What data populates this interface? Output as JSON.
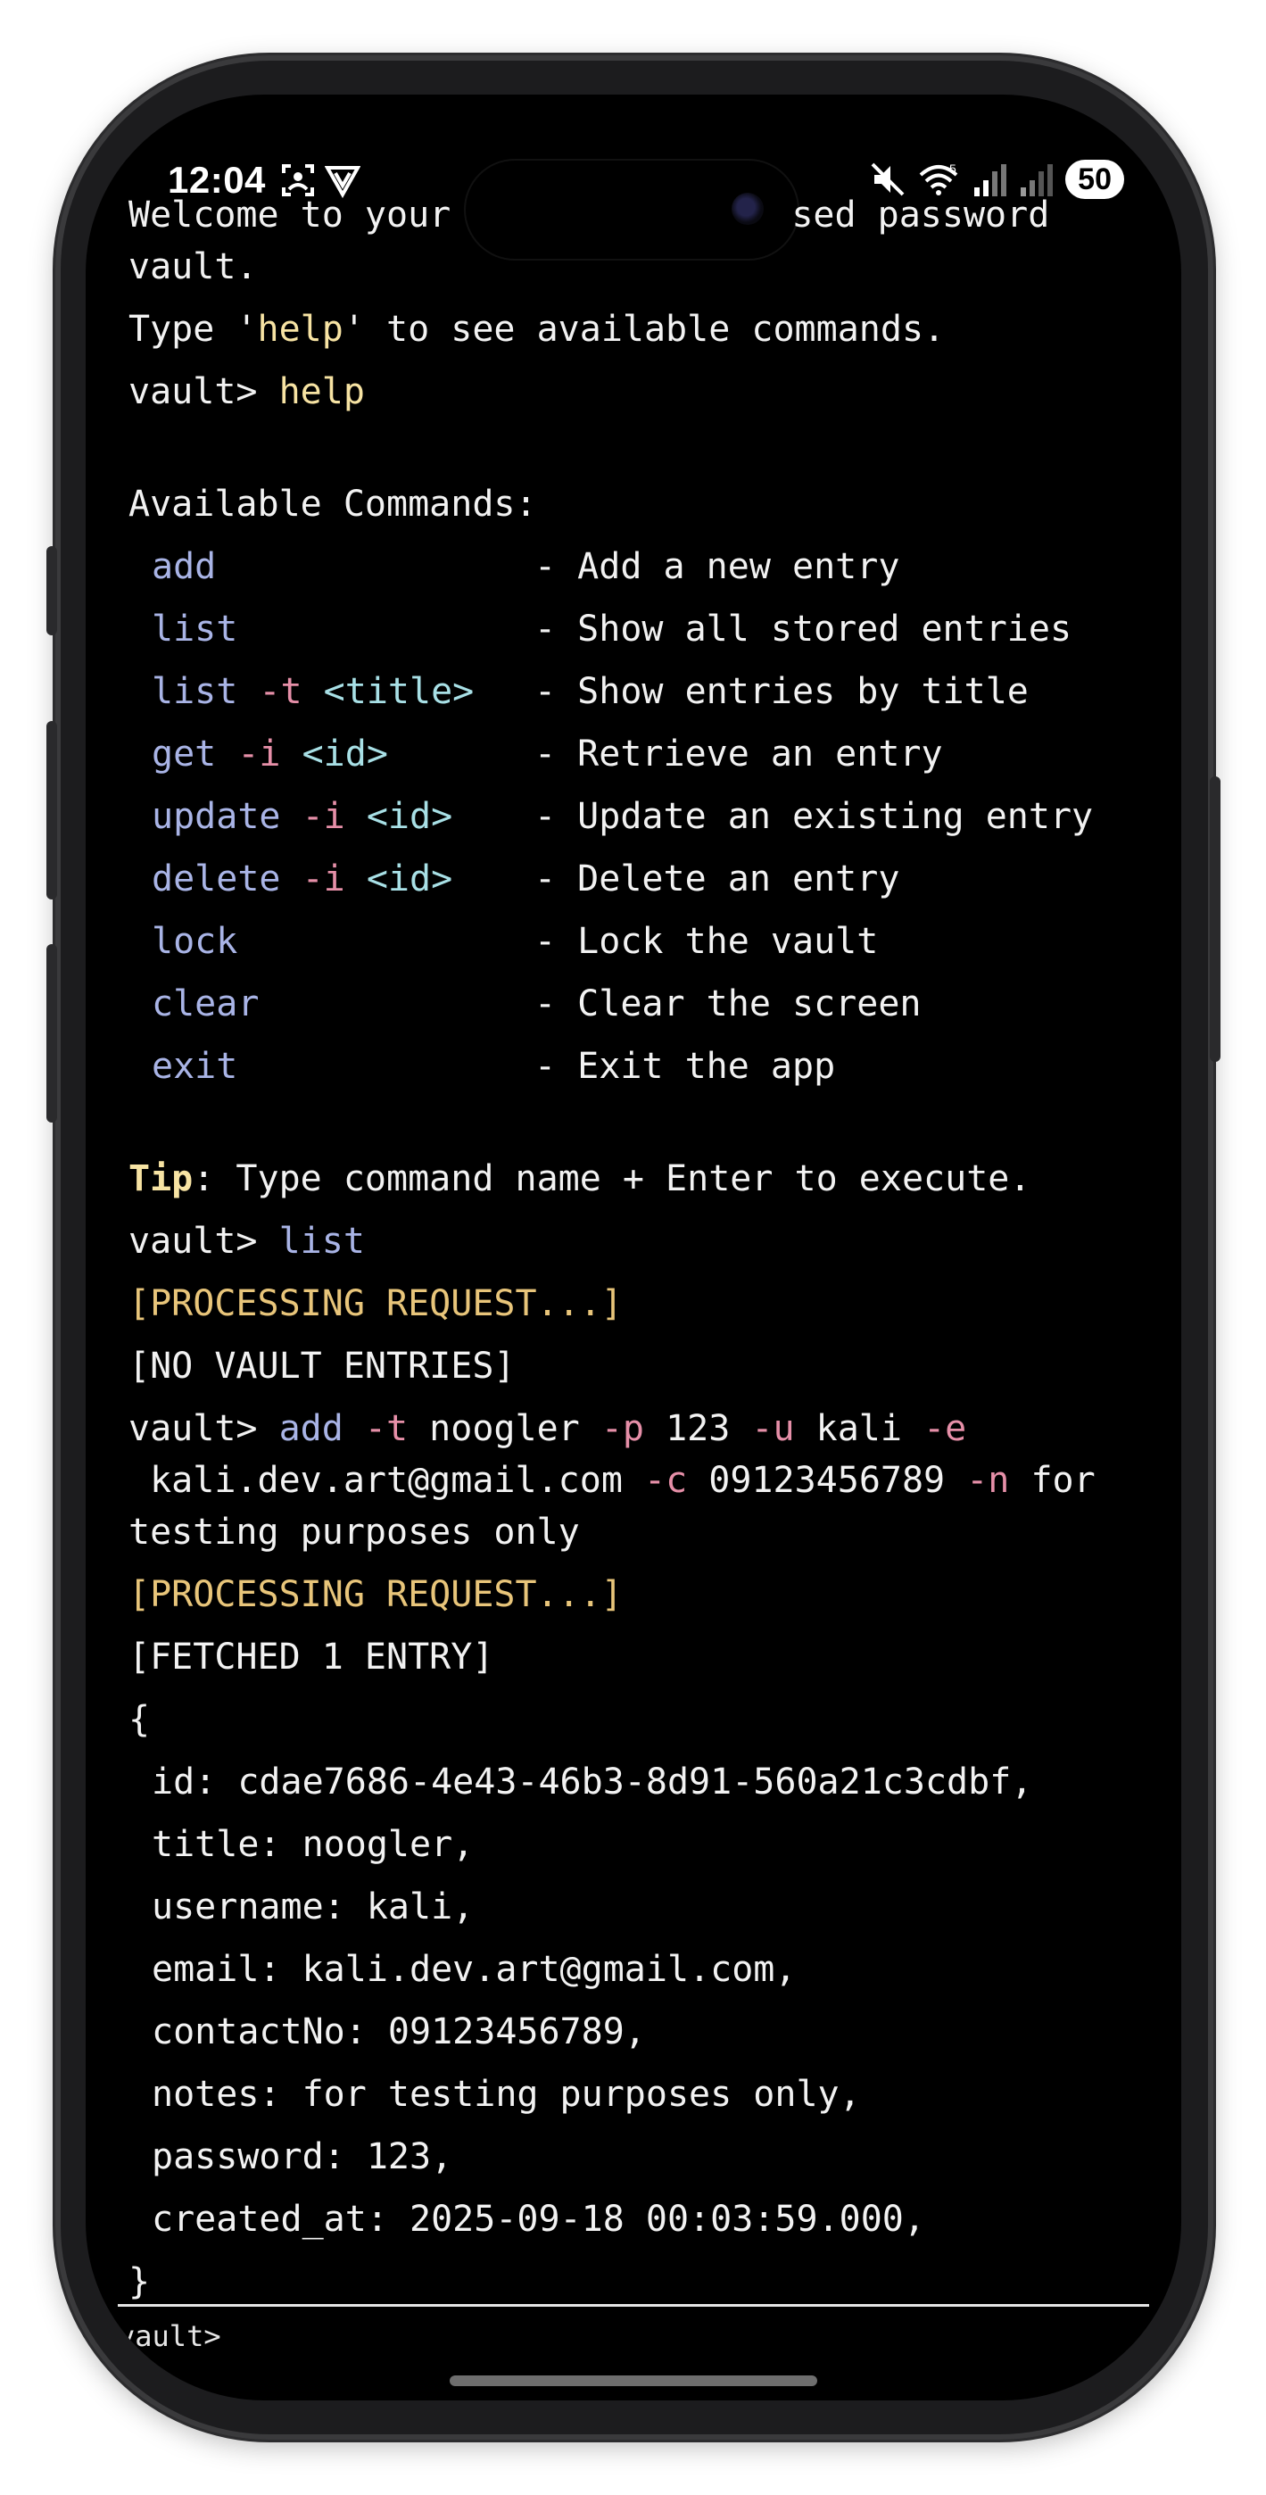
{
  "status": {
    "time": "12:04",
    "battery": "50",
    "icons_left": [
      "screenshot-icon",
      "shield-v-icon"
    ],
    "icons_right": [
      "mute-icon",
      "wifi-icon",
      "signal-icon",
      "signal-icon-2"
    ]
  },
  "terminal": {
    "welcome_a": "Welcome to your ",
    "welcome_b": "sed password",
    "welcome_c": "vault.",
    "type_prefix": "Type '",
    "type_keyword": "help",
    "type_suffix": "' to see available commands.",
    "prompt": "vault> ",
    "cmd_help": "help",
    "available": "Available Commands:",
    "commands": [
      {
        "c": "add",
        "f": "",
        "a": "",
        "d": "- Add a new entry"
      },
      {
        "c": "list",
        "f": "",
        "a": "",
        "d": "- Show all stored entries"
      },
      {
        "c": "list",
        "f": " -t",
        "a": " <title>",
        "d": "- Show entries by title"
      },
      {
        "c": "get",
        "f": " -i",
        "a": " <id>",
        "d": "- Retrieve an entry"
      },
      {
        "c": "update",
        "f": " -i",
        "a": " <id>",
        "d": "- Update an existing entry"
      },
      {
        "c": "delete",
        "f": " -i",
        "a": " <id>",
        "d": "- Delete an entry"
      },
      {
        "c": "lock",
        "f": "",
        "a": "",
        "d": "- Lock the vault"
      },
      {
        "c": "clear",
        "f": "",
        "a": "",
        "d": "- Clear the screen"
      },
      {
        "c": "exit",
        "f": "",
        "a": "",
        "d": "- Exit the app"
      }
    ],
    "tip_label": "Tip",
    "tip_text": ": Type command name + Enter to execute.",
    "cmd_list": "list",
    "processing": "[PROCESSING REQUEST...]",
    "no_entries": "[NO VAULT ENTRIES]",
    "add_cmd": {
      "c": "add",
      "t_flag": " -t",
      "t_val": " noogler",
      "p_flag": " -p",
      "p_val": " 123",
      "u_flag": " -u",
      "u_val": " kali",
      "e_flag": " -e",
      "e_val": " kali.dev.art@gmail.com",
      "c_flag": " -c",
      "c_val": " 09123456789",
      "n_flag": " -n",
      "n_val": " for testing purposes only"
    },
    "fetched": "[FETCHED 1 ENTRY]",
    "brace_open": "{",
    "entry": [
      "id: cdae7686-4e43-46b3-8d91-560a21c3cdbf,",
      "title: noogler,",
      "username: kali,",
      "email: kali.dev.art@gmail.com,",
      "contactNo: 09123456789,",
      "notes: for testing purposes only,",
      "password: 123,",
      "created_at: 2025-09-18 00:03:59.000,"
    ],
    "brace_close": "}"
  },
  "input": {
    "prompt": "vault>"
  }
}
